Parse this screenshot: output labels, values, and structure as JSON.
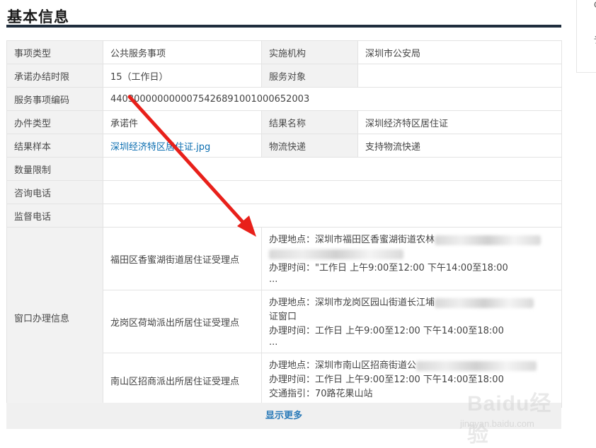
{
  "title": "基本信息",
  "rows": {
    "item_type": {
      "label": "事项类型",
      "value": "公共服务事项"
    },
    "agency": {
      "label": "实施机构",
      "value": "深圳市公安局"
    },
    "deadline": {
      "label": "承诺办结时限",
      "value": "15（工作日）"
    },
    "service_target": {
      "label": "服务对象",
      "value": ""
    },
    "item_code": {
      "label": "服务事项编码",
      "value": "440300000000007542689100100065200​3"
    },
    "handle_type": {
      "label": "办件类型",
      "value": "承诺件"
    },
    "result_name": {
      "label": "结果名称",
      "value": "深圳经济特区居住证"
    },
    "result_sample": {
      "label": "结果样本",
      "value": "深圳经济特区居住证.jpg"
    },
    "logistics": {
      "label": "物流快递",
      "value": "支持物流快递"
    },
    "quantity_limit": {
      "label": "数量限制",
      "value": ""
    },
    "consult_phone": {
      "label": "咨询电话",
      "value": ""
    },
    "supervise_phone": {
      "label": "监督电话",
      "value": ""
    }
  },
  "window": {
    "label": "窗口办理信息",
    "offices": [
      {
        "name": "福田区香蜜湖街道居住证受理点",
        "address_prefix": "办理地点：深圳市福田区香蜜湖街道农林",
        "hours": "办理时间：\"工作日 上午9:00至12:00 下午14:00至18:00",
        "ellipsis": "..."
      },
      {
        "name": "龙岗区荷坳派出所居住证受理点",
        "address_prefix": "办理地点：深圳市龙岗区园山街道长江埔",
        "address_suffix": "证窗口",
        "hours": "办理时间：工作日 上午9:00至12:00 下午14:00至18:00",
        "ellipsis": "..."
      },
      {
        "name": "南山区招商派出所居住证受理点",
        "address_prefix": "办理地点：深圳市南山区招商街道公",
        "hours": "办理时间：工作日 上午9:00至12:00 下午14:00至18:00",
        "traffic": "交通指引：70路花果山站"
      }
    ]
  },
  "show_more": "显示更多",
  "watermark": {
    "logo": "Baidu经验",
    "sub": "jingyan.baidu.com"
  },
  "colors": {
    "title_rule": "#1f2d3d",
    "link": "#0a6db0",
    "arrow": "#e8201a"
  }
}
